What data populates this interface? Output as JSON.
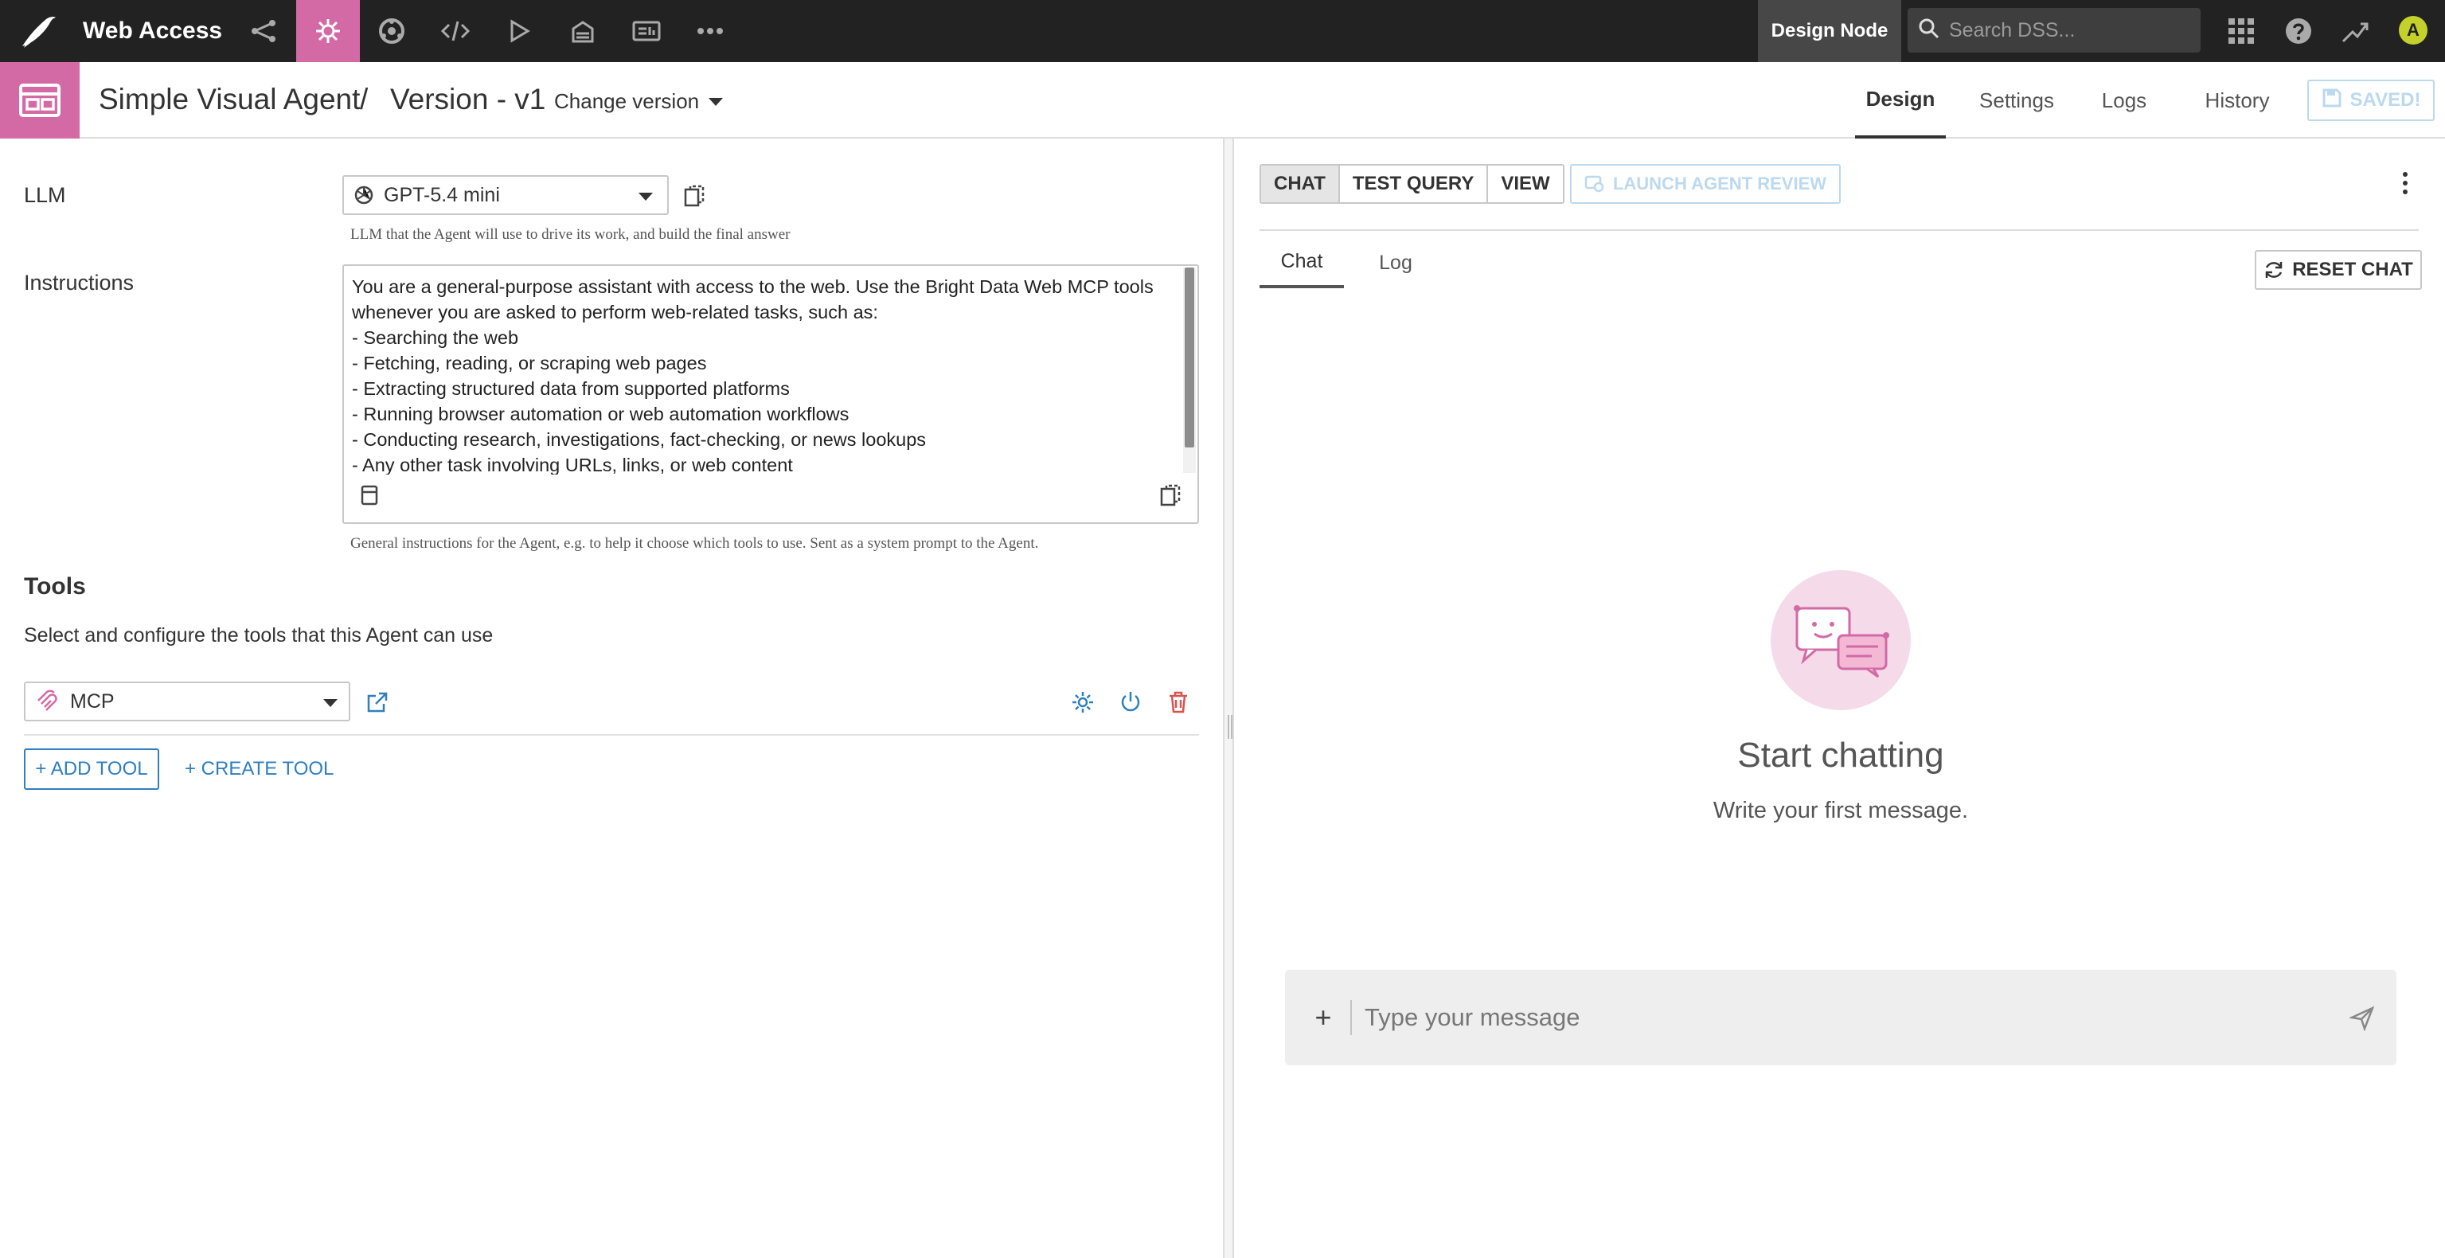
{
  "topbar": {
    "project_name": "Web Access",
    "nav_icons": [
      "flow-icon",
      "agent-icon",
      "lab-icon",
      "code-icon",
      "run-icon",
      "deploy-icon",
      "dashboard-icon",
      "more-icon"
    ],
    "active_nav_icon": "agent-icon",
    "node_label": "Design Node",
    "search_placeholder": "Search DSS...",
    "right_icons": [
      "apps-grid-icon",
      "help-icon",
      "activity-icon"
    ],
    "avatar_letter": "A",
    "colors": {
      "bar_bg": "#222222",
      "accent": "#d36aa6",
      "avatar": "#c4d12a"
    }
  },
  "header": {
    "title": "Simple Visual Agent",
    "separator": "/",
    "version": "Version - v1",
    "change_version_label": "Change version",
    "tabs": [
      {
        "label": "Design",
        "active": true
      },
      {
        "label": "Settings",
        "active": false
      },
      {
        "label": "Logs",
        "active": false
      },
      {
        "label": "History",
        "active": false
      }
    ],
    "saved_label": "SAVED!"
  },
  "left": {
    "llm_label": "LLM",
    "llm_value": "GPT-5.4 mini",
    "llm_help": "LLM that the Agent will use to drive its work, and build the final answer",
    "instructions_label": "Instructions",
    "instructions_text": "You are a general-purpose assistant with access to the web. Use the Bright Data Web MCP tools\nwhenever you are asked to perform web-related tasks, such as:\n- Searching the web\n- Fetching, reading, or scraping web pages\n- Extracting structured data from supported platforms\n- Running browser automation or web automation workflows\n- Conducting research, investigations, fact-checking, or news lookups\n- Any other task involving URLs, links, or web content",
    "instructions_help": "General instructions for the Agent, e.g. to help it choose which tools to use. Sent as a system prompt to the Agent.",
    "tools_title": "Tools",
    "tools_desc": "Select and configure the tools that this Agent can use",
    "tool_value": "MCP",
    "add_tool_label": "+ ADD TOOL",
    "create_tool_label": "+ CREATE TOOL",
    "link_color": "#2f7fc1",
    "delete_color": "#d9534f"
  },
  "right": {
    "mode_tabs": [
      {
        "label": "CHAT",
        "active": true
      },
      {
        "label": "TEST QUERY",
        "active": false
      },
      {
        "label": "VIEW",
        "active": false
      }
    ],
    "launch_review_label": "LAUNCH AGENT REVIEW",
    "subtabs": [
      {
        "label": "Chat",
        "active": true
      },
      {
        "label": "Log",
        "active": false
      }
    ],
    "reset_chat_label": "RESET CHAT",
    "empty_title": "Start chatting",
    "empty_subtitle": "Write your first message.",
    "composer_placeholder": "Type your message",
    "composer_plus": "+"
  }
}
